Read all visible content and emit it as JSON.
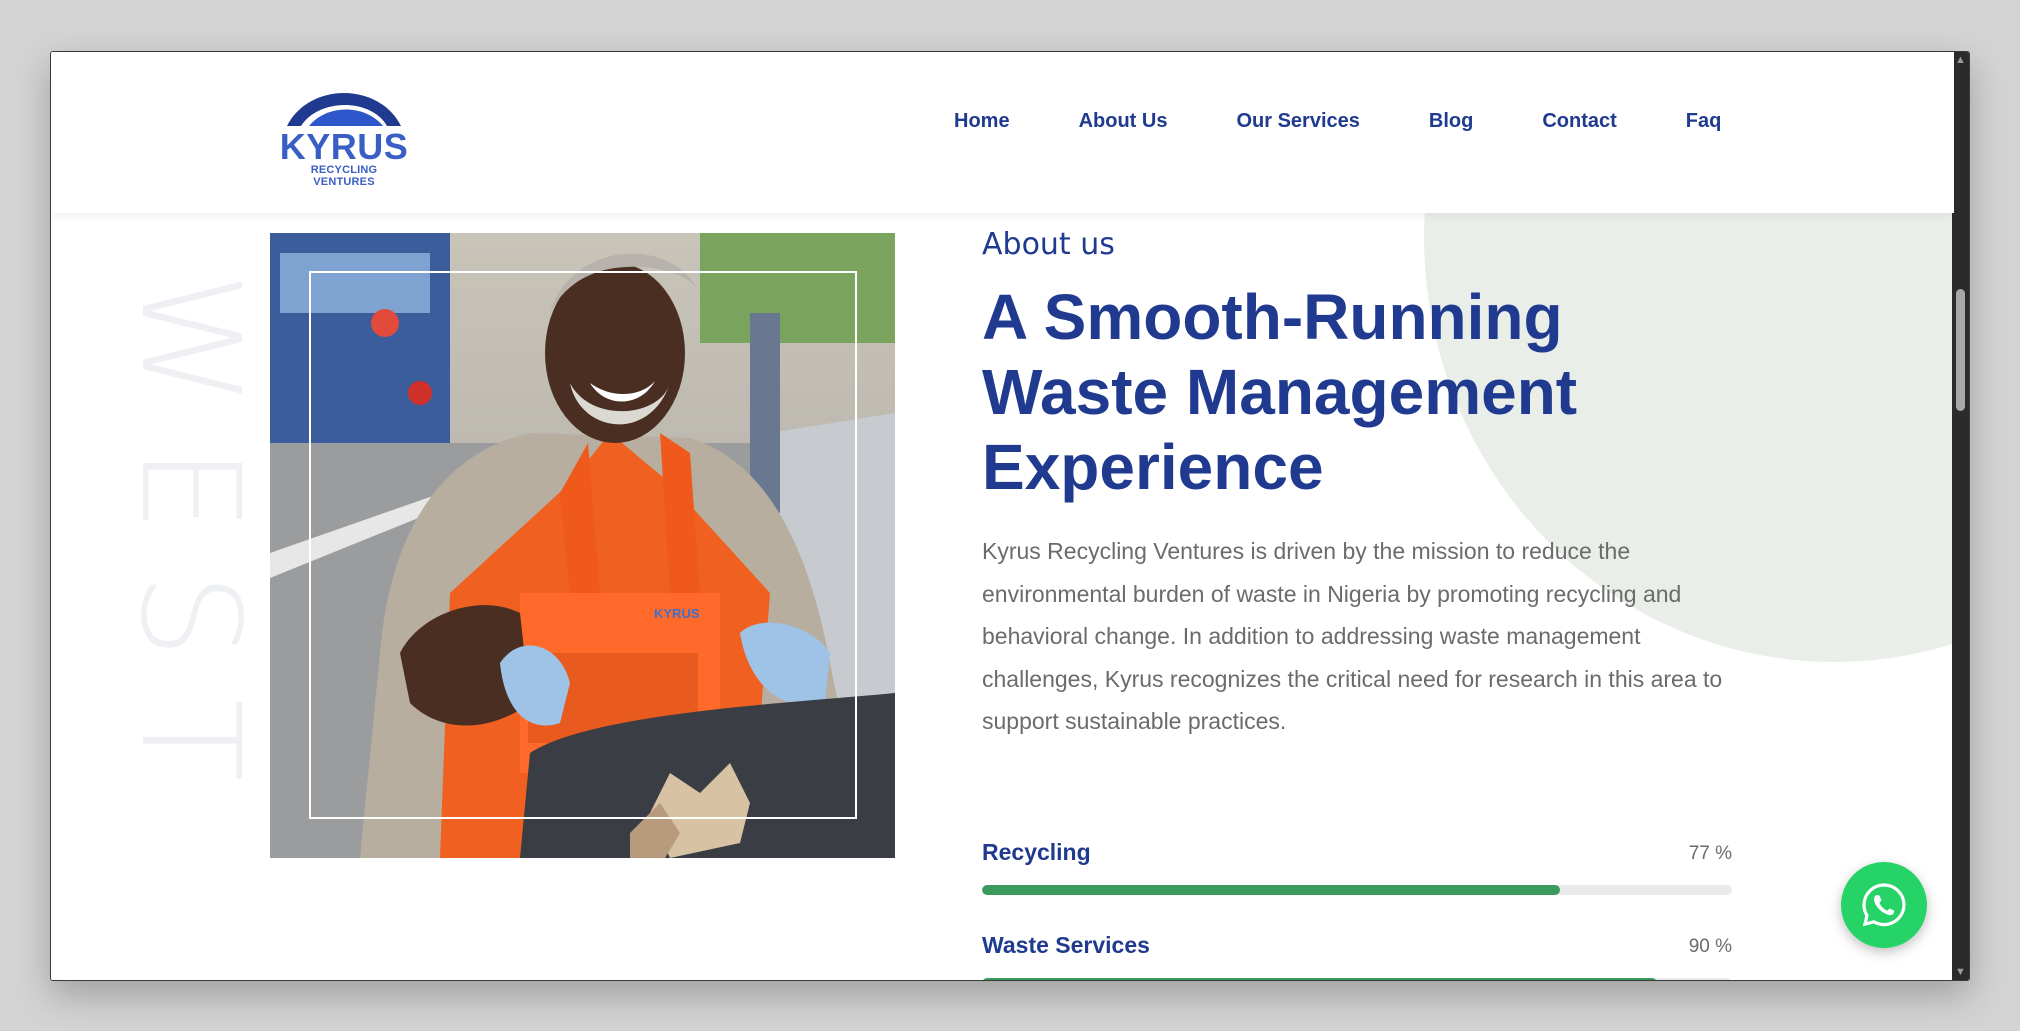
{
  "logo": {
    "name": "KYRUS",
    "tagline": "RECYCLING VENTURES"
  },
  "nav": [
    {
      "label": "Home"
    },
    {
      "label": "About Us"
    },
    {
      "label": "Our Services"
    },
    {
      "label": "Blog"
    },
    {
      "label": "Contact"
    },
    {
      "label": "Faq"
    }
  ],
  "decor": {
    "vertical_word": "WEST"
  },
  "about": {
    "eyebrow": "About us",
    "heading": "A Smooth-Running Waste Management Experience",
    "paragraph": "Kyrus Recycling Ventures is driven by the mission to reduce the environmental burden of waste in Nigeria by promoting recycling and behavioral change. In addition to addressing waste management challenges, Kyrus recognizes the critical need for research in this area to support sustainable practices.",
    "skills": [
      {
        "label": "Recycling",
        "percent_label": "77 %",
        "value": 77
      },
      {
        "label": "Waste Services",
        "percent_label": "90 %",
        "value": 90
      }
    ]
  },
  "colors": {
    "brand_navy": "#1f3a8f",
    "logo_blue": "#3a5fc4",
    "progress_green": "#3c9a5f",
    "whatsapp_green": "#25d366",
    "circle_bg": "#eaeee9"
  },
  "icons": {
    "whatsapp": "whatsapp-icon"
  }
}
